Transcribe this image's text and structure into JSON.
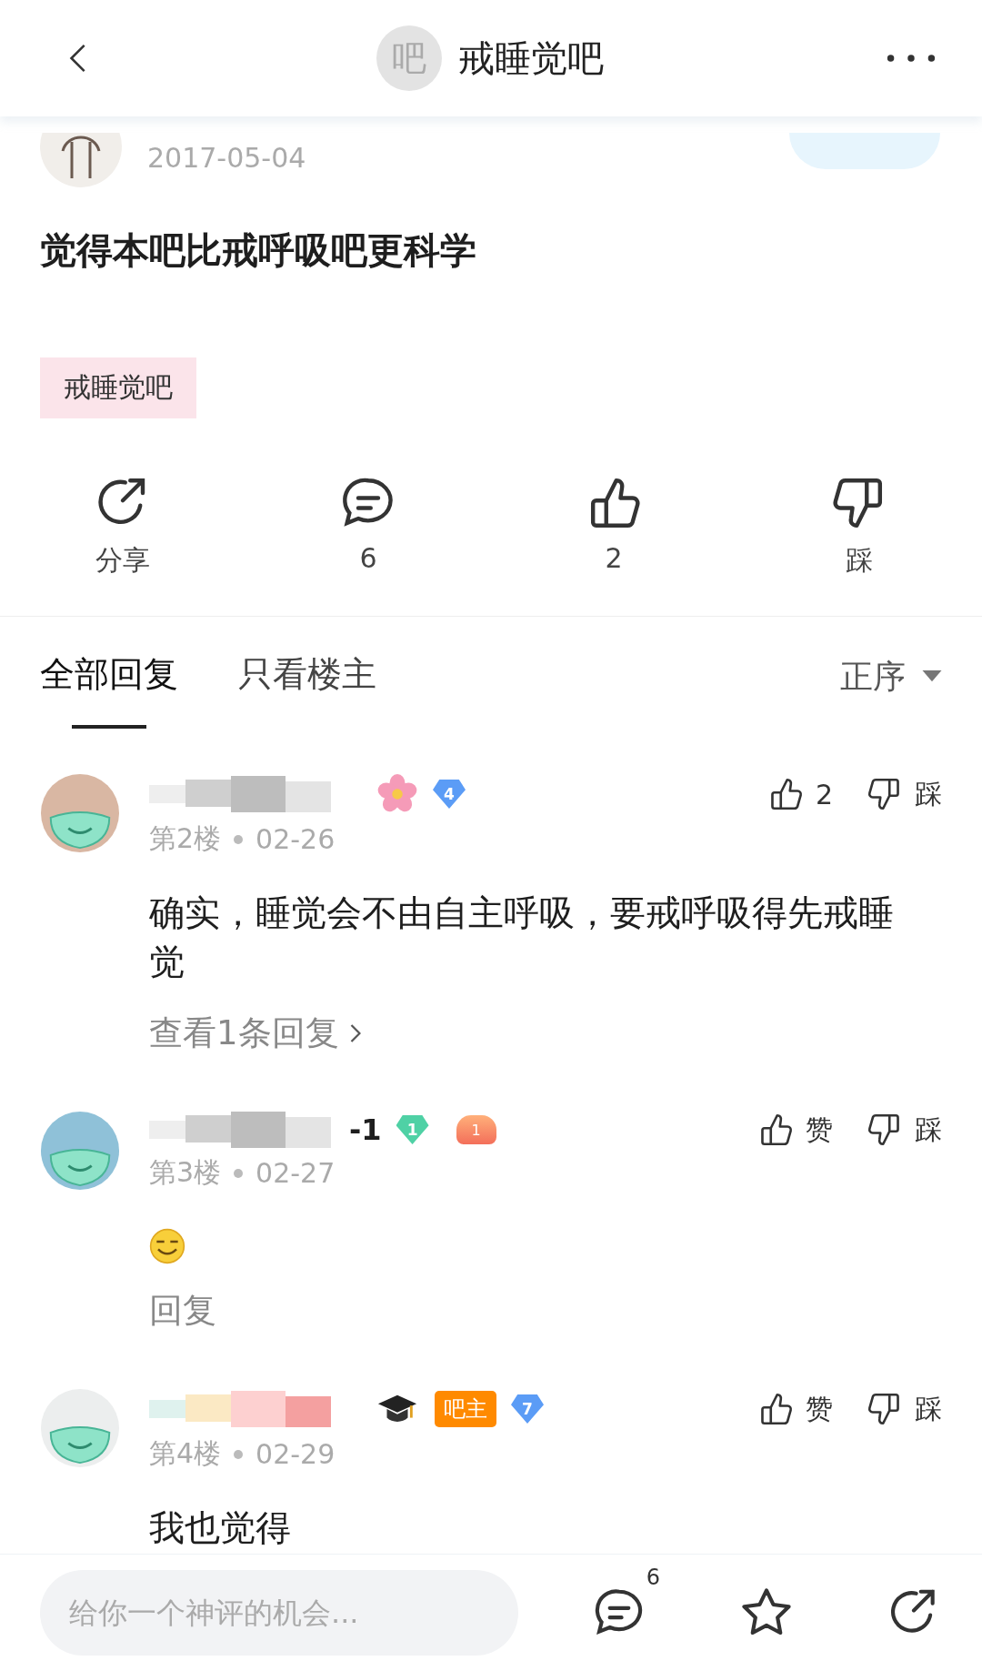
{
  "header": {
    "forum_icon": "吧",
    "forum_name": "戒睡觉吧"
  },
  "post": {
    "date": "2017-05-04",
    "title": "觉得本吧比戒呼吸吧更科学",
    "tag": "戒睡觉吧",
    "actions": [
      {
        "kind": "share",
        "label": "分享"
      },
      {
        "kind": "comment",
        "label": "6"
      },
      {
        "kind": "like",
        "label": "2"
      },
      {
        "kind": "dislike",
        "label": "踩"
      }
    ]
  },
  "reply_tabs": {
    "tabs": [
      {
        "label": "全部回复",
        "selected": true
      },
      {
        "label": "只看楼主",
        "selected": false
      }
    ],
    "sort": "正序"
  },
  "replies": [
    {
      "badges": [
        {
          "kind": "flower"
        },
        {
          "kind": "level",
          "text": "4",
          "color": "#5b9cf6"
        }
      ],
      "floor": "第2楼",
      "date": "02-26",
      "text": "确实，睡觉会不由自主呼吸，要戒呼吸得先戒睡觉",
      "emoji": false,
      "like": "2",
      "dislike": "踩",
      "replies_link": "查看1条回复"
    },
    {
      "name_visible": "-1",
      "badges": [
        {
          "kind": "level",
          "text": "1",
          "color": "#4fd1a5"
        },
        {
          "kind": "lungs",
          "text": "1"
        }
      ],
      "floor": "第3楼",
      "date": "02-27",
      "emoji": true,
      "like": "赞",
      "dislike": "踩",
      "reply_link": "回复"
    },
    {
      "badges": [
        {
          "kind": "cap"
        },
        {
          "kind": "admin",
          "text": "吧主"
        },
        {
          "kind": "level",
          "text": "7",
          "color": "#5b9cf6"
        }
      ],
      "floor": "第4楼",
      "date": "02-29",
      "text": "我也觉得",
      "emoji": false,
      "like": "赞",
      "dislike": "踩"
    }
  ],
  "bottom_bar": {
    "placeholder": "给你一个神评的机会...",
    "comment_count": "6"
  }
}
